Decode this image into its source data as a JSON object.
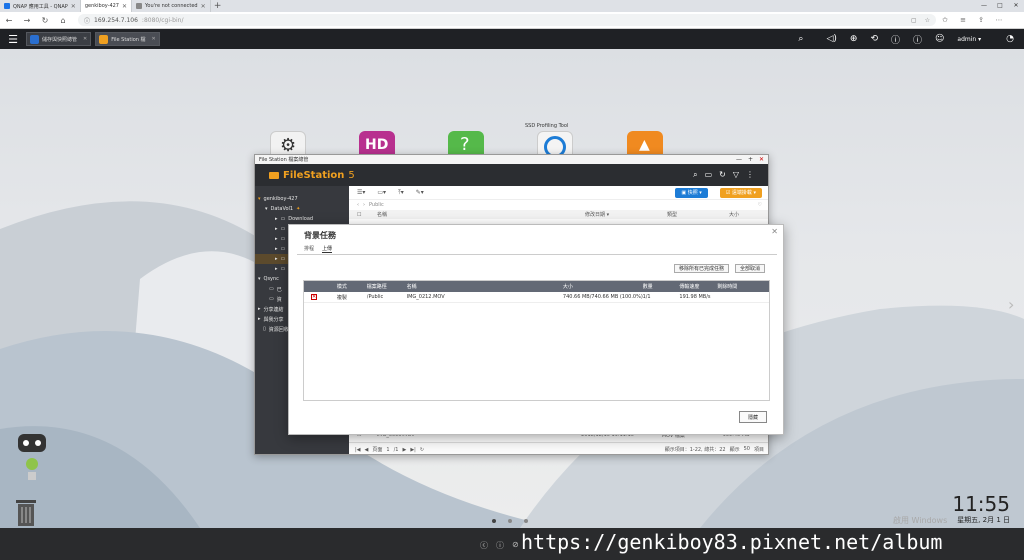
{
  "browser": {
    "tabs": [
      {
        "label": "QNAP 應用工具 - QNAP",
        "favicon": "#1a73e8"
      },
      {
        "label": "genkiboy-427",
        "favicon": "",
        "active": true
      },
      {
        "label": "You're not connected",
        "favicon": "#888888"
      }
    ],
    "new_tab": "+",
    "window_controls": [
      "—",
      "□",
      "✕"
    ],
    "url_host": "169.254.7.106",
    "url_path": ":8080/cgi-bin/"
  },
  "qts": {
    "app_tabs": [
      {
        "label": "儲存與快照總管",
        "color": "#2a6fd0"
      },
      {
        "label": "File Station 檔",
        "color": "#f0a020"
      }
    ],
    "user": "admin ▾",
    "right_icons": [
      "search-icon",
      "volume-icon",
      "gamepad-icon",
      "sync-icon",
      "notification-icon",
      "info-icon",
      "user-icon",
      "dashboard-icon"
    ]
  },
  "desktop": {
    "icon_label": "SSD Profiling Tool",
    "clock_time": "11:55",
    "clock_date": "星期五, 2月 1 日",
    "windows_watermark": "啟用 Windows",
    "url_watermark": "https://genkiboy83.pixnet.net/album"
  },
  "filestation": {
    "window_title": "File Station 檔案總管",
    "brand": "FileStation",
    "version": "5",
    "sidebar": [
      {
        "label": "genkiboy-427",
        "indent": 0,
        "mark": "▾"
      },
      {
        "label": "DataVol1",
        "indent": 1,
        "mark": "▾"
      },
      {
        "label": "Download",
        "indent": 2,
        "mark": "▸"
      },
      {
        "label": "I",
        "indent": 2,
        "mark": "▸"
      },
      {
        "label": "P",
        "indent": 2,
        "mark": "▸"
      },
      {
        "label": "P",
        "indent": 2,
        "mark": "▸"
      },
      {
        "label": "P",
        "indent": 2,
        "mark": "▸",
        "selected": true
      },
      {
        "label": "V",
        "indent": 2,
        "mark": "▸"
      },
      {
        "label": "Qsync",
        "indent": 0,
        "mark": "▾"
      },
      {
        "label": "已",
        "indent": 1,
        "mark": ""
      },
      {
        "label": "資",
        "indent": 1,
        "mark": ""
      },
      {
        "label": "分享連結",
        "indent": 0,
        "mark": "▸"
      },
      {
        "label": "與我分享",
        "indent": 0,
        "mark": "▸"
      },
      {
        "label": "資源回收",
        "indent": 0,
        "mark": ""
      }
    ],
    "toolbar_icons": [
      "list-icon",
      "new-folder-icon",
      "upload-icon",
      "tools-icon"
    ],
    "btn_upload": "▣ 快照 ▾",
    "btn_remote": "☑ 遠端掛載 ▾",
    "path": "Public",
    "columns": [
      "名稱",
      "修改日期 ▾",
      "類型",
      "大小"
    ],
    "bottom_row": {
      "name": "IMG_0095.MOV",
      "date": "2018/12/10 19:11:10",
      "type": "MOV 檔案",
      "size": "959.40 MB"
    },
    "footer": {
      "page_label": "頁面",
      "page": "1",
      "of": "/1",
      "showing": "顯示項目：1-22, 總共：22",
      "per_page_label": "顯示",
      "per_page": "50",
      "unit": "項目"
    }
  },
  "dialog": {
    "title": "背景任務",
    "tabs": [
      "排程",
      "上傳"
    ],
    "btn_clear_done": "移除所有已完成任務",
    "btn_clear_all": "全部取消",
    "columns": [
      "",
      "模式",
      "檔案路徑",
      "名稱",
      "大小",
      "數量",
      "傳輸速度",
      "剩餘時間"
    ],
    "rows": [
      {
        "mode": "複製",
        "path": "/Public",
        "name": "IMG_0212.MOV",
        "size": "740.66 MB/740.66 MB (100.0%)",
        "count": "1/1",
        "speed": "191.98 MB/s",
        "remaining": ""
      }
    ],
    "btn_hide": "隱藏"
  }
}
